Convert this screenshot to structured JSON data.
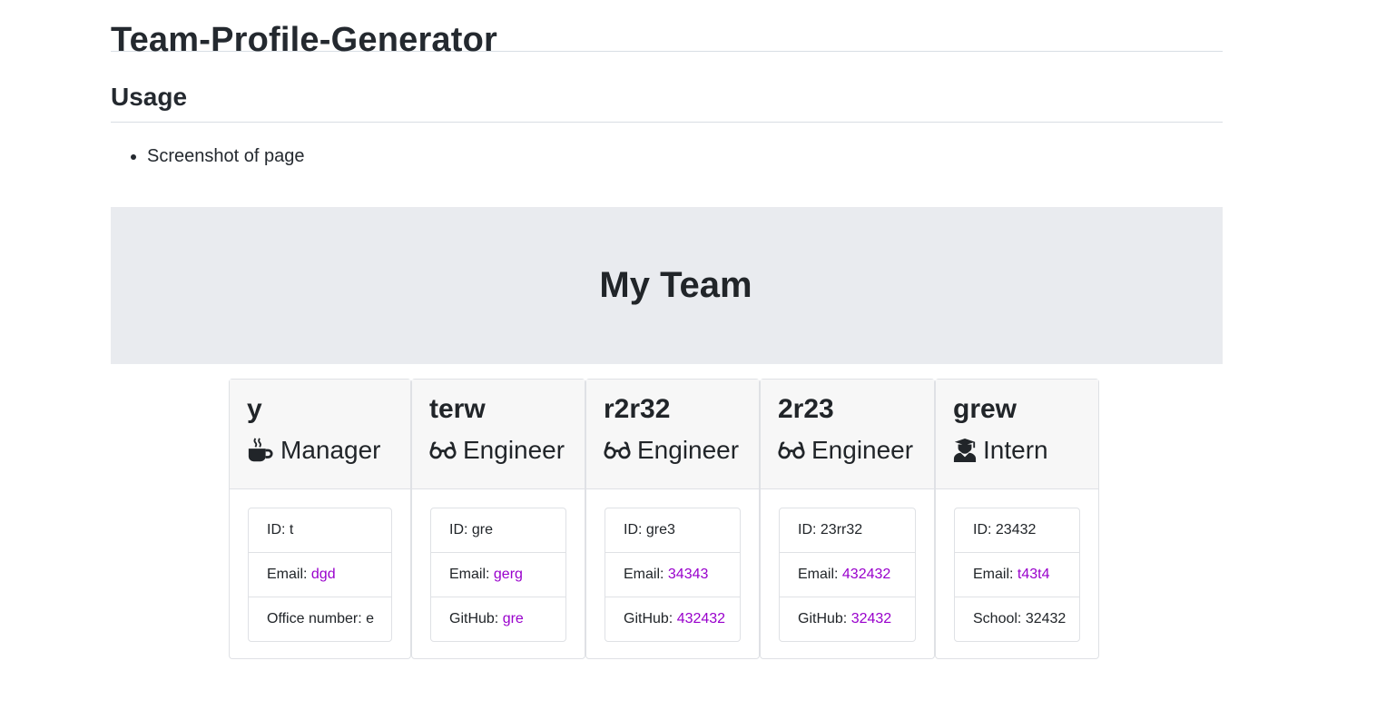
{
  "readme": {
    "title": "Team-Profile-Generator",
    "usage_heading": "Usage",
    "usage_items": [
      "Screenshot of page"
    ]
  },
  "team_page": {
    "heading": "My Team",
    "link_color": "#9900cc",
    "cards": [
      {
        "name": "y",
        "role": "Manager",
        "icon": "coffee-mug-icon",
        "id_label": "ID: ",
        "id": "t",
        "email_label": "Email: ",
        "email": "dgd",
        "extra_label": "Office number: ",
        "extra": "e"
      },
      {
        "name": "terw",
        "role": "Engineer",
        "icon": "glasses-icon",
        "id_label": "ID: ",
        "id": "gre",
        "email_label": "Email: ",
        "email": "gerg",
        "extra_label": "GitHub: ",
        "extra": "gre"
      },
      {
        "name": "r2r32",
        "role": "Engineer",
        "icon": "glasses-icon",
        "id_label": "ID: ",
        "id": "gre3",
        "email_label": "Email: ",
        "email": "34343",
        "extra_label": "GitHub: ",
        "extra": "432432"
      },
      {
        "name": "2r23",
        "role": "Engineer",
        "icon": "glasses-icon",
        "id_label": "ID: ",
        "id": "23rr32",
        "email_label": "Email: ",
        "email": "432432",
        "extra_label": "GitHub: ",
        "extra": "32432"
      },
      {
        "name": "grew",
        "role": "Intern",
        "icon": "graduate-icon",
        "id_label": "ID: ",
        "id": "23432",
        "email_label": "Email: ",
        "email": "t43t4",
        "extra_label": "School: ",
        "extra": "32432"
      }
    ]
  }
}
